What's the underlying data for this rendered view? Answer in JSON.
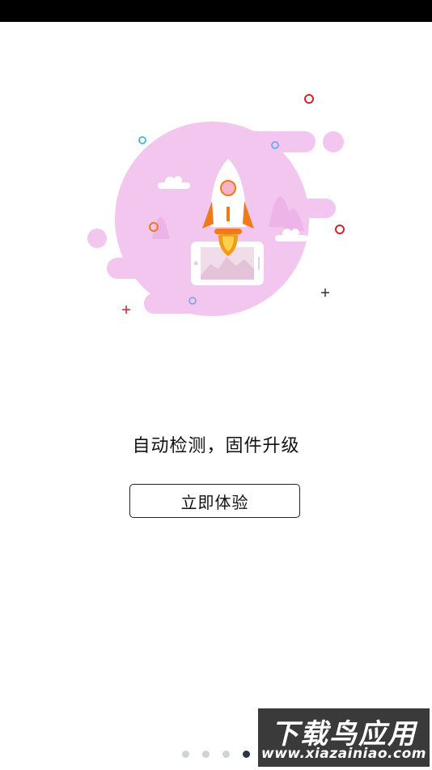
{
  "main": {
    "headline": "自动检测，固件升级",
    "cta_label": "立即体验"
  },
  "pager": {
    "count": 5,
    "active_index": 3
  },
  "watermark": {
    "title": "下载鸟应用",
    "url": "www.xiazainiao.com"
  },
  "colors": {
    "blob": "#f3c6f0",
    "accent_orange": "#f07a1a",
    "accent_red": "#d9222a",
    "dot_active": "#2b3448",
    "dot_inactive": "#cfd2d6"
  },
  "illustration": {
    "name": "rocket-launch-illustration"
  }
}
